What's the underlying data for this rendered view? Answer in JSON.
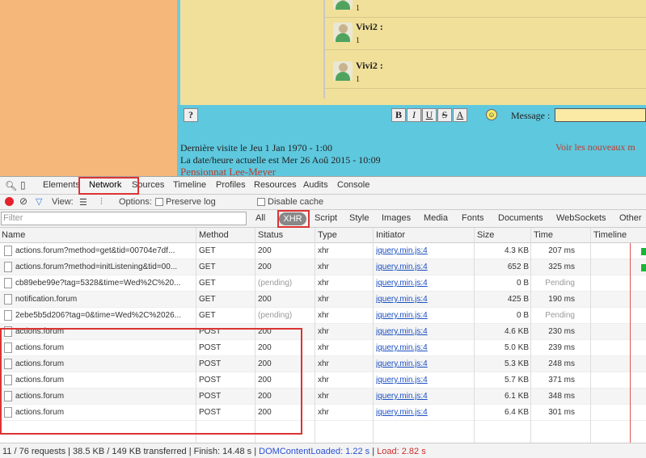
{
  "page": {
    "messages": [
      {
        "author": "",
        "text": "1"
      },
      {
        "author": "Vivi2 :",
        "text": "1"
      },
      {
        "author": "Vivi2 :",
        "text": "1"
      }
    ],
    "toolbar": {
      "help_label": "?",
      "bold": "B",
      "italic": "I",
      "underline": "U",
      "strike": "S",
      "color": "A",
      "smiley": "☺",
      "message_label": "Message :"
    },
    "info": {
      "last_visit": "Dernière visite le Jeu 1 Jan 1970 - 1:00",
      "current_date": "La date/heure actuelle est Mer 26 Aoû 2015 - 10:09",
      "new_messages": "Voir les nouveaux m",
      "forum_name": "Pensionnat Lee-Meyer"
    }
  },
  "devtools": {
    "tabs": [
      "Elements",
      "Network",
      "Sources",
      "Timeline",
      "Profiles",
      "Resources",
      "Audits",
      "Console"
    ],
    "active_tab": "Network",
    "controls": {
      "view_label": "View:",
      "options_label": "Options:",
      "preserve_log": "Preserve log",
      "disable_cache": "Disable cache"
    },
    "filter": {
      "placeholder": "Filter",
      "types": [
        "All",
        "XHR",
        "Script",
        "Style",
        "Images",
        "Media",
        "Fonts",
        "Documents",
        "WebSockets",
        "Other"
      ],
      "active_type": "XHR"
    },
    "columns": [
      "Name",
      "Method",
      "Status",
      "Type",
      "Initiator",
      "Size",
      "Time",
      "Timeline"
    ],
    "rows": [
      {
        "name": "actions.forum?method=get&tid=00704e7df...",
        "method": "GET",
        "status": "200",
        "type": "xhr",
        "initiator": "jquery.min.js:4",
        "size": "4.3 KB",
        "time": "207 ms",
        "timeline": true
      },
      {
        "name": "actions.forum?method=initListening&tid=00...",
        "method": "GET",
        "status": "200",
        "type": "xhr",
        "initiator": "jquery.min.js:4",
        "size": "652 B",
        "time": "325 ms",
        "timeline": true
      },
      {
        "name": "cb89ebe99e?tag=5328&time=Wed%2C%20...",
        "method": "GET",
        "status": "(pending)",
        "type": "xhr",
        "initiator": "jquery.min.js:4",
        "size": "0 B",
        "time": "Pending",
        "timeline": false
      },
      {
        "name": "notification.forum",
        "method": "GET",
        "status": "200",
        "type": "xhr",
        "initiator": "jquery.min.js:4",
        "size": "425 B",
        "time": "190 ms",
        "timeline": false
      },
      {
        "name": "2ebe5b5d206?tag=0&time=Wed%2C%2026...",
        "method": "GET",
        "status": "(pending)",
        "type": "xhr",
        "initiator": "jquery.min.js:4",
        "size": "0 B",
        "time": "Pending",
        "timeline": false
      },
      {
        "name": "actions.forum",
        "method": "POST",
        "status": "200",
        "type": "xhr",
        "initiator": "jquery.min.js:4",
        "size": "4.6 KB",
        "time": "230 ms",
        "timeline": false
      },
      {
        "name": "actions.forum",
        "method": "POST",
        "status": "200",
        "type": "xhr",
        "initiator": "jquery.min.js:4",
        "size": "5.0 KB",
        "time": "239 ms",
        "timeline": false
      },
      {
        "name": "actions.forum",
        "method": "POST",
        "status": "200",
        "type": "xhr",
        "initiator": "jquery.min.js:4",
        "size": "5.3 KB",
        "time": "248 ms",
        "timeline": false
      },
      {
        "name": "actions.forum",
        "method": "POST",
        "status": "200",
        "type": "xhr",
        "initiator": "jquery.min.js:4",
        "size": "5.7 KB",
        "time": "371 ms",
        "timeline": false
      },
      {
        "name": "actions.forum",
        "method": "POST",
        "status": "200",
        "type": "xhr",
        "initiator": "jquery.min.js:4",
        "size": "6.1 KB",
        "time": "348 ms",
        "timeline": false
      },
      {
        "name": "actions.forum",
        "method": "POST",
        "status": "200",
        "type": "xhr",
        "initiator": "jquery.min.js:4",
        "size": "6.4 KB",
        "time": "301 ms",
        "timeline": false
      }
    ],
    "status": {
      "summary": "11 / 76 requests | 38.5 KB / 149 KB transferred | Finish: 14.48 s |",
      "dcl": "DOMContentLoaded: 1.22 s",
      "sep": "|",
      "load": "Load: 2.82 s"
    }
  }
}
